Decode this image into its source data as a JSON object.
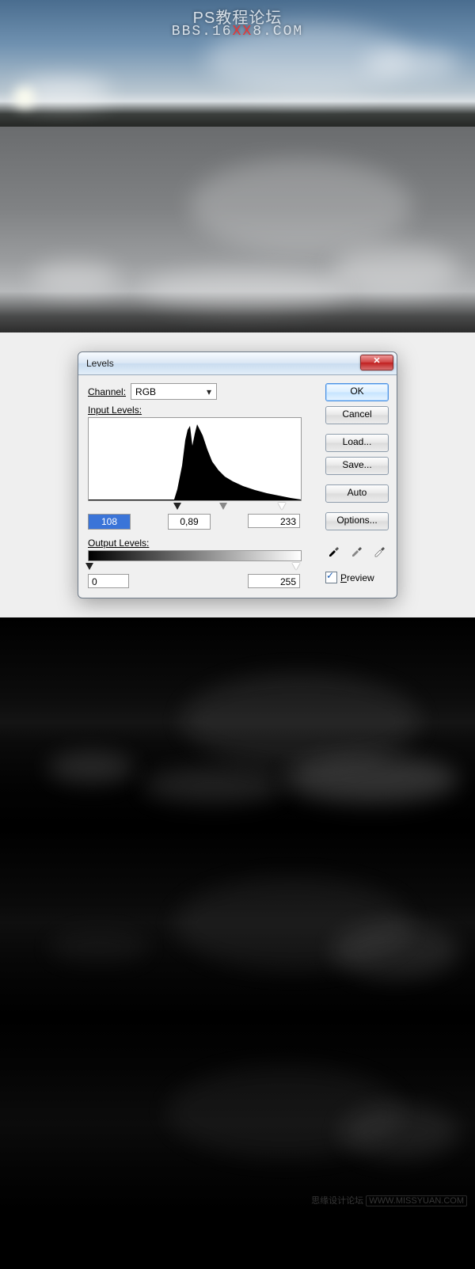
{
  "banner": {
    "line1": "PS教程论坛",
    "line2_pre": "BBS.16",
    "line2_xx": "XX",
    "line2_post": "8.COM"
  },
  "dialog": {
    "title": "Levels",
    "channel_label": "Channel:",
    "channel_value": "RGB",
    "input_label": "Input Levels:",
    "input_black": "108",
    "input_gamma": "0,89",
    "input_white": "233",
    "output_label": "Output Levels:",
    "output_black": "0",
    "output_white": "255",
    "btn_ok": "OK",
    "btn_cancel": "Cancel",
    "btn_load": "Load...",
    "btn_save": "Save...",
    "btn_auto": "Auto",
    "btn_options": "Options...",
    "preview_label": "Preview",
    "close_glyph": "✕",
    "dropdown_glyph": "▾"
  },
  "footer": {
    "credit": "思缘设计论坛",
    "site": "WWW.MISSYUAN.COM"
  }
}
